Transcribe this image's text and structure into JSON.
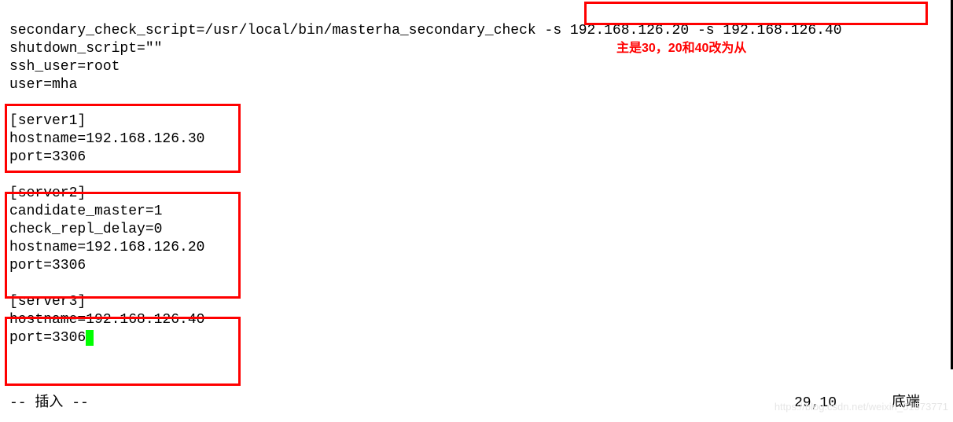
{
  "config": {
    "lines_top": [
      "secondary_check_script=/usr/local/bin/masterha_secondary_check -s 192.168.126.20 -s 192.168.126.40",
      "shutdown_script=\"\"",
      "ssh_user=root",
      "user=mha"
    ],
    "server1": {
      "header": "[server1]",
      "hostname": "hostname=192.168.126.30",
      "port": "port=3306"
    },
    "server2": {
      "header": "[server2]",
      "candidate": "candidate_master=1",
      "check": "check_repl_delay=0",
      "hostname": "hostname=192.168.126.20",
      "port": "port=3306"
    },
    "server3": {
      "header": "[server3]",
      "hostname": "hostname=192.168.126.40",
      "port": "port=3306"
    }
  },
  "annotation": {
    "text": "主是30，20和40改为从"
  },
  "status": {
    "mode": "-- 插入 --",
    "position": "29,10",
    "scroll": "底端"
  },
  "watermark": "https://blog.csdn.net/weixin_51573771"
}
